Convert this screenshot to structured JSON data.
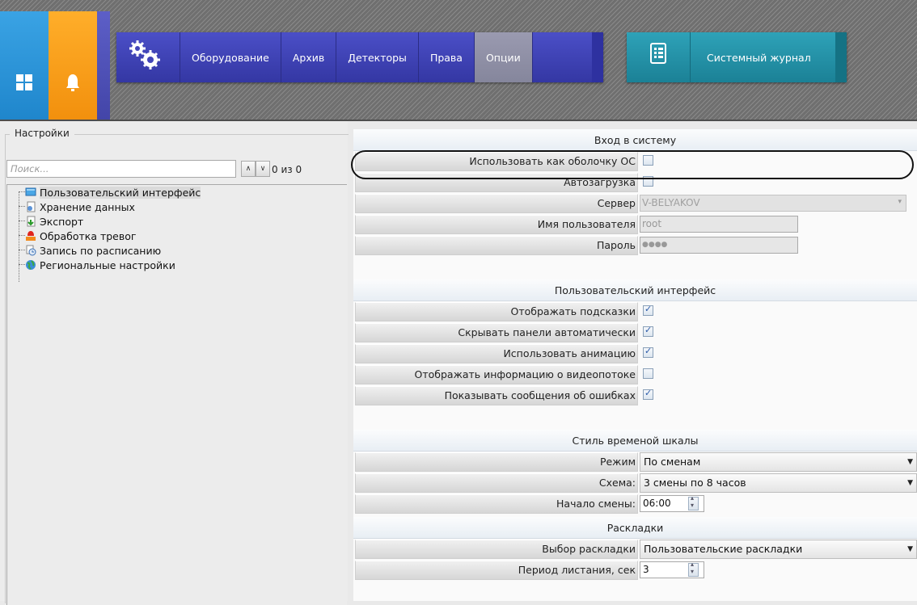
{
  "nav": {
    "items": [
      "Оборудование",
      "Архив",
      "Детекторы",
      "Права",
      "Опции"
    ],
    "active": "Опции",
    "journal_label": "Системный журнал"
  },
  "left": {
    "group_title": "Настройки",
    "search_placeholder": "Поиск...",
    "counter": "0 из 0",
    "tree": [
      {
        "label": "Пользовательский интерфейс",
        "icon": "monitor-icon"
      },
      {
        "label": "Хранение данных",
        "icon": "storage-icon"
      },
      {
        "label": "Экспорт",
        "icon": "export-icon"
      },
      {
        "label": "Обработка тревог",
        "icon": "alarm-icon"
      },
      {
        "label": "Запись по расписанию",
        "icon": "schedule-icon"
      },
      {
        "label": "Региональные настройки",
        "icon": "globe-icon"
      }
    ]
  },
  "settings": {
    "login": {
      "title": "Вход в систему",
      "shell_label": "Использовать как оболочку ОС",
      "shell_checked": false,
      "autoload_label": "Автозагрузка",
      "autoload_checked": false,
      "server_label": "Сервер",
      "server_value": "V-BELYAKOV",
      "user_label": "Имя пользователя",
      "user_value": "root",
      "password_label": "Пароль",
      "password_value": "●●●●"
    },
    "ui": {
      "title": "Пользовательский интерфейс",
      "hints_label": "Отображать подсказки",
      "hints_checked": true,
      "hide_panels_label": "Скрывать панели автоматически",
      "hide_panels_checked": true,
      "animation_label": "Использовать анимацию",
      "animation_checked": true,
      "stream_info_label": "Отображать информацию о видеопотоке",
      "stream_info_checked": false,
      "errors_label": "Показывать сообщения об ошибках",
      "errors_checked": true
    },
    "timeline": {
      "title": "Стиль временой шкалы",
      "mode_label": "Режим",
      "mode_value": "По сменам",
      "scheme_label": "Схема:",
      "scheme_value": "3 смены по 8 часов",
      "start_label": "Начало смены:",
      "start_value": "06:00"
    },
    "layouts": {
      "title": "Раскладки",
      "choice_label": "Выбор раскладки",
      "choice_value": "Пользовательские раскладки",
      "period_label": "Период листания, сек",
      "period_value": "3"
    }
  }
}
